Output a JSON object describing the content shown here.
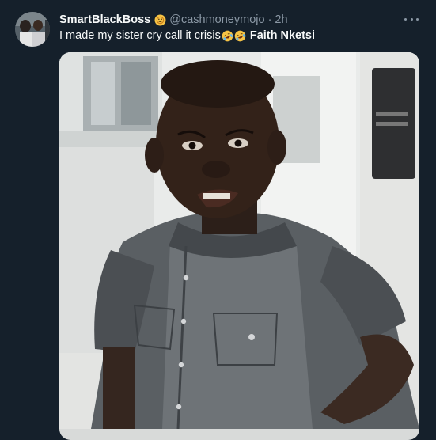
{
  "tweet": {
    "display_name": "SmartBlackBoss",
    "badge_icon": "smiley-badge-icon",
    "handle": "@cashmoneymojo",
    "separator": "·",
    "time": "2h",
    "text": "I made my sister cry call it crisis",
    "emojis": [
      "rolling-on-floor-laughing-icon",
      "rolling-on-floor-laughing-icon"
    ],
    "tag": "Faith Nketsi"
  },
  "colors": {
    "background": "#15202b",
    "primary_text": "#f7f9f9",
    "secondary_text": "#8b98a5"
  }
}
